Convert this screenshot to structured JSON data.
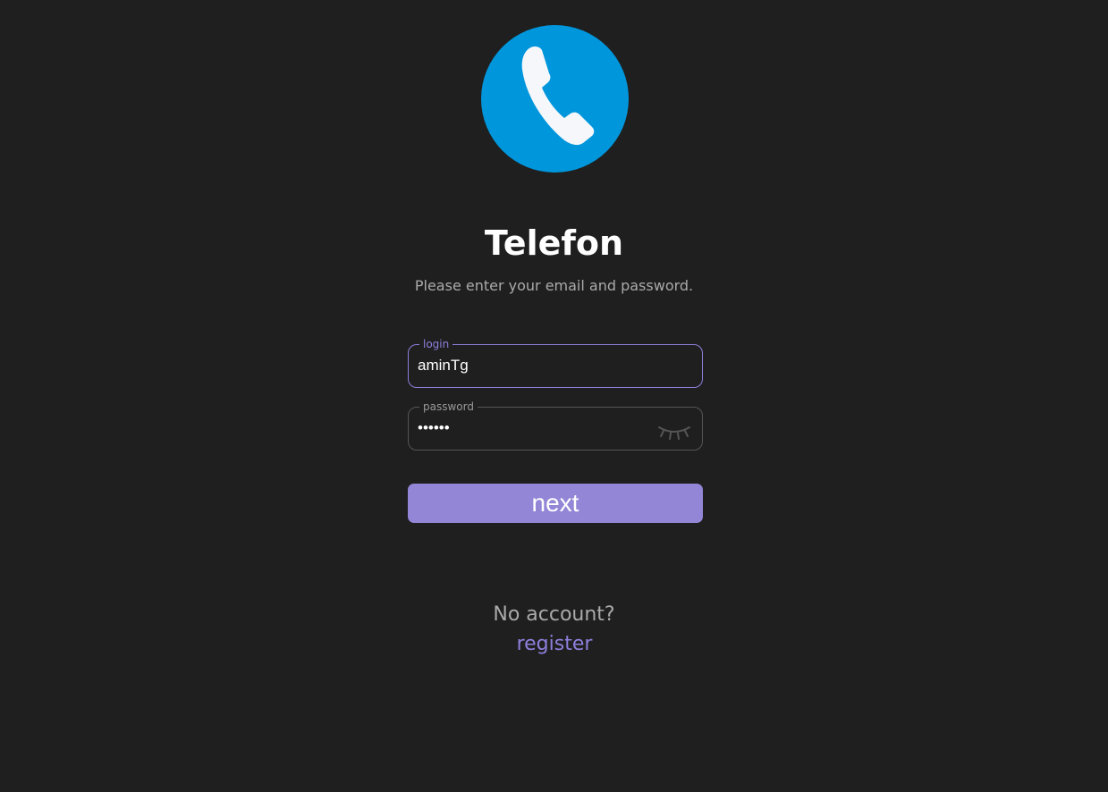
{
  "app": {
    "title": "Telefon",
    "subtitle": "Please enter your email and password."
  },
  "logo": {
    "icon": "phone-icon",
    "background_color": "#0096dc",
    "glyph_color": "#f5f7fa"
  },
  "form": {
    "login": {
      "label": "login",
      "value": "aminTg"
    },
    "password": {
      "label": "password",
      "value": "••••••",
      "toggle_icon": "eye-closed-icon"
    },
    "submit_label": "next"
  },
  "footer": {
    "prompt": "No account?",
    "register_label": "register"
  },
  "colors": {
    "background": "#1f1f1f",
    "accent": "#8f7fdc",
    "button": "#9386d6",
    "muted_text": "#aaaaaa"
  }
}
